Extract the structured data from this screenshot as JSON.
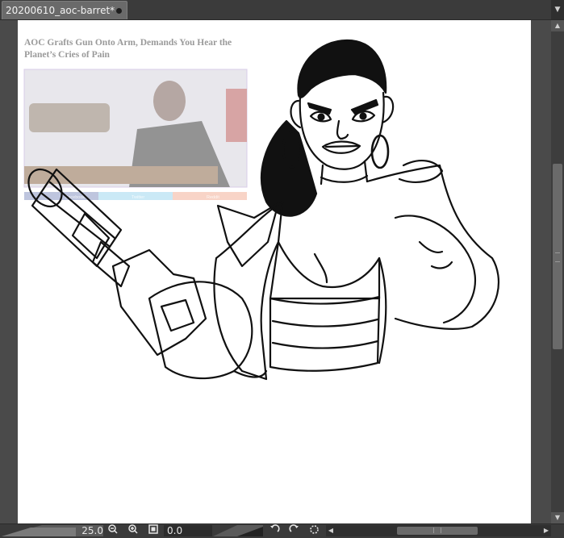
{
  "document": {
    "tab_title": "20200610_aoc-barret*",
    "tab_modified_icon": "dot-icon"
  },
  "reference": {
    "headline_line1": "AOC Grafts Gun Onto Arm, Demands You Hear the",
    "headline_line2": "Planet’s Cries of Pain",
    "share_buttons": [
      "Facebook",
      "Twitter",
      "Reddit"
    ],
    "share_colors": [
      "#8a97c4",
      "#9fd8f0",
      "#f4b29a"
    ]
  },
  "status_bar": {
    "zoom_value": "25.0",
    "rotation_value": "0.0",
    "icons": [
      "zoom-out-icon",
      "zoom-in-icon",
      "fit-to-screen-icon",
      "rotate-left-icon",
      "rotate-right-icon",
      "reset-rotation-icon"
    ]
  },
  "colors": {
    "workspace": "#4a4a4a",
    "tab_active": "#6a6a6a",
    "paper": "#ffffff",
    "ink": "#111111"
  }
}
